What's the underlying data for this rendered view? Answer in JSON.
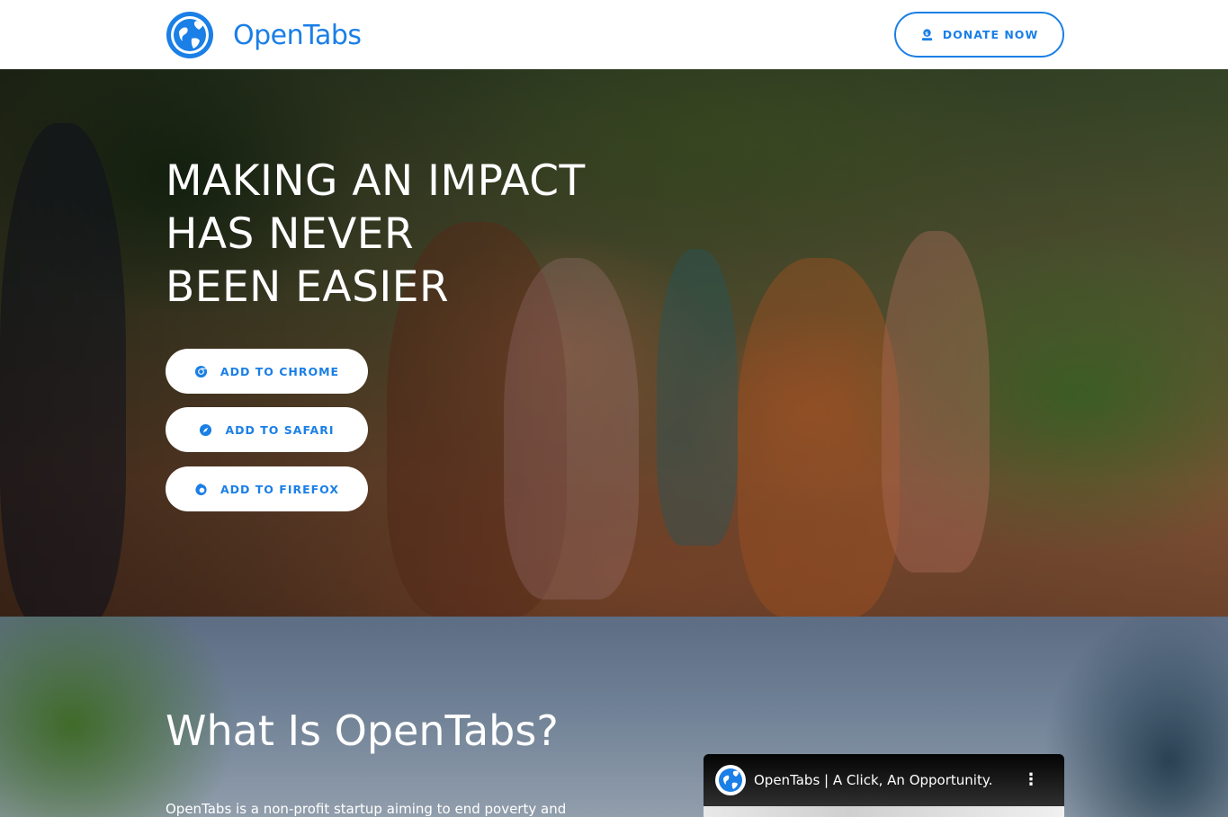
{
  "header": {
    "brand_name": "OpenTabs",
    "donate_label": "DONATE NOW"
  },
  "hero": {
    "title_lines": [
      "MAKING AN IMPACT",
      "HAS NEVER",
      "BEEN EASIER"
    ],
    "buttons": [
      {
        "label": "ADD TO CHROME",
        "icon": "chrome-icon"
      },
      {
        "label": "ADD TO SAFARI",
        "icon": "safari-icon"
      },
      {
        "label": "ADD TO FIREFOX",
        "icon": "firefox-icon"
      }
    ]
  },
  "about": {
    "title": "What Is OpenTabs?",
    "text": "OpenTabs is a non-profit startup aiming to end poverty and",
    "video": {
      "title": "OpenTabs | A Click, An Opportunity.",
      "menu_icon": "more-vertical-icon"
    }
  },
  "colors": {
    "accent": "#1a7fe6",
    "header_bg": "#ffffff",
    "button_bg": "#ffffff"
  }
}
